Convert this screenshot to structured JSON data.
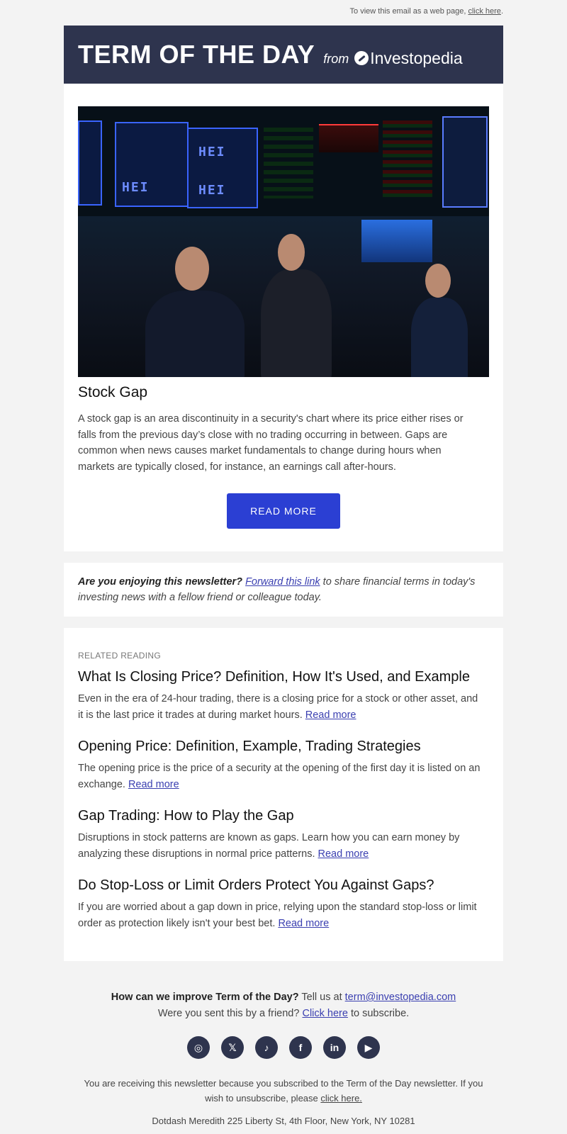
{
  "preheader": {
    "text": "To view this email as a web page,",
    "link": "click here",
    "suffix": "."
  },
  "header": {
    "title": "TERM OF THE DAY",
    "from": "from",
    "brand": "Investopedia"
  },
  "article": {
    "title": "Stock Gap",
    "body": "A stock gap is an area discontinuity in a security's chart where its price either rises or falls from the previous day’s close with no trading occurring in between. Gaps are common when news causes market fundamentals to change during hours when markets are typically closed, for instance, an earnings call after-hours.",
    "button": "READ MORE",
    "hero_panel_label": "HEI"
  },
  "promo": {
    "lead": "Are you enjoying this newsletter?",
    "link": "Forward this link",
    "rest": "to share financial terms in today's investing news with a fellow friend or colleague today."
  },
  "related": {
    "label": "RELATED READING",
    "items": [
      {
        "title": "What Is Closing Price? Definition, How It's Used, and Example",
        "body": "Even in the era of 24-hour trading, there is a closing price for a stock or other asset, and it is the last price it trades at during market hours.",
        "link": "Read more"
      },
      {
        "title": "Opening Price: Definition, Example, Trading Strategies",
        "body": "The opening price is the price of a security at the opening of the first day it is listed on an exchange.",
        "link": "Read more"
      },
      {
        "title": "Gap Trading: How to Play the Gap",
        "body": "Disruptions in stock patterns are known as gaps. Learn how you can earn money by analyzing these disruptions in normal price patterns.",
        "link": "Read more"
      },
      {
        "title": "Do Stop-Loss or Limit Orders Protect You Against Gaps?",
        "body": "If you are worried about a gap down in price, relying upon the standard stop-loss or limit order as protection likely isn't your best bet.",
        "link": "Read more"
      }
    ]
  },
  "footer": {
    "question": "How can we improve Term of the Day?",
    "tell": "Tell us at",
    "email": "term@investopedia.com",
    "friend_prefix": "Were you sent this by a friend?",
    "friend_link": "Click here",
    "friend_suffix": "to subscribe.",
    "socials": [
      {
        "name": "instagram-icon",
        "glyph": "◎"
      },
      {
        "name": "x-icon",
        "glyph": "𝕏"
      },
      {
        "name": "tiktok-icon",
        "glyph": "♪"
      },
      {
        "name": "facebook-icon",
        "glyph": "f"
      },
      {
        "name": "linkedin-icon",
        "glyph": "in"
      },
      {
        "name": "youtube-icon",
        "glyph": "▶"
      }
    ],
    "legal": "You are receiving this newsletter because you subscribed to the Term of the Day newsletter. If you wish to unsubscribe, please",
    "legal_link": "click here.",
    "address": "Dotdash Meredith 225 Liberty St, 4th Floor, New York, NY 10281"
  },
  "colors": {
    "header_bg": "#2e344e",
    "button": "#2b3fd3",
    "link": "#3a3fb0",
    "page_bg": "#f3f3f3"
  }
}
